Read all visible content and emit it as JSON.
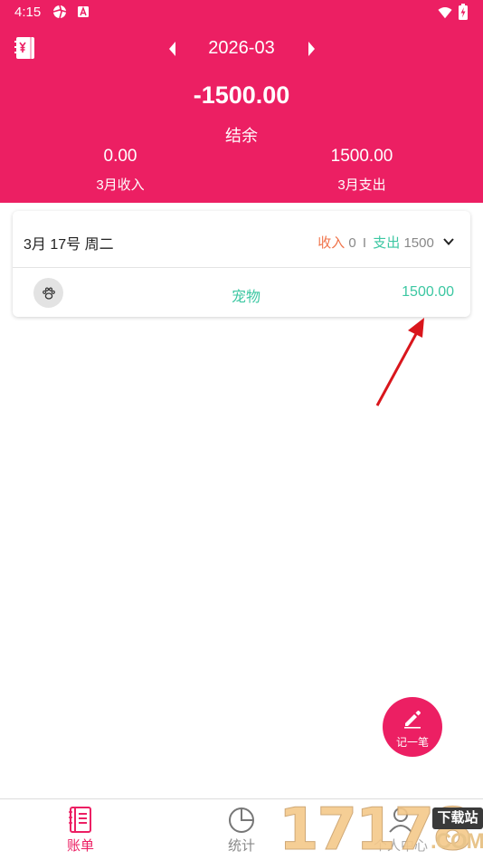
{
  "status_bar": {
    "time": "4:15"
  },
  "header": {
    "month": "2026-03",
    "balance": "-1500.00",
    "balance_label": "结余",
    "income_value": "0.00",
    "income_label": "3月收入",
    "expense_value": "1500.00",
    "expense_label": "3月支出"
  },
  "day_card": {
    "date": "3月 17号 周二",
    "income_label": "收入",
    "income_value": "0",
    "separator": "I",
    "expense_label": "支出",
    "expense_value": "1500",
    "records": [
      {
        "icon": "paw-icon",
        "category": "宠物",
        "amount": "1500.00"
      }
    ]
  },
  "fab": {
    "label": "记一笔",
    "icon": "pencil-icon"
  },
  "bottom_nav": {
    "items": [
      {
        "label": "账单",
        "icon": "bill-icon",
        "active": true
      },
      {
        "label": "统计",
        "icon": "pie-chart-icon",
        "active": false
      },
      {
        "label": "个人中心",
        "icon": "person-icon",
        "active": false
      }
    ]
  },
  "watermark": {
    "digits": "17178",
    "badge": "下载站",
    "suffix": ".COM"
  },
  "colors": {
    "primary": "#ec1f63",
    "income": "#f0734a",
    "expense": "#3cc7a2",
    "annotation_arrow": "#d9161c"
  }
}
